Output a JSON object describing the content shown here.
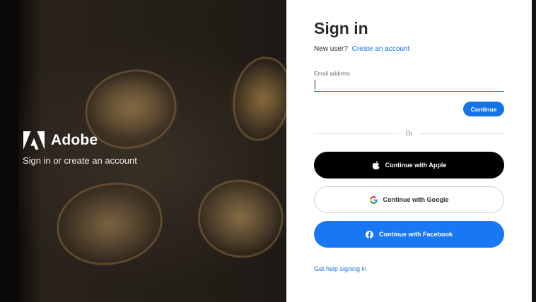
{
  "brand": {
    "name": "Adobe",
    "tagline": "Sign in or create an account"
  },
  "signin": {
    "title": "Sign in",
    "new_user_text": "New user?",
    "create_account_link": "Create an account",
    "email_label": "Email address",
    "email_value": "",
    "continue_label": "Continue",
    "or_text": "Or",
    "apple_label": "Continue with Apple",
    "google_label": "Continue with Google",
    "facebook_label": "Continue with Facebook",
    "help_link": "Get help signing in"
  },
  "icons": {
    "brand_logo": "adobe-logo-icon",
    "apple": "apple-icon",
    "google": "google-icon",
    "facebook": "facebook-icon"
  },
  "colors": {
    "accent": "#1473e6",
    "facebook": "#1877f2",
    "apple_button": "#000000"
  }
}
